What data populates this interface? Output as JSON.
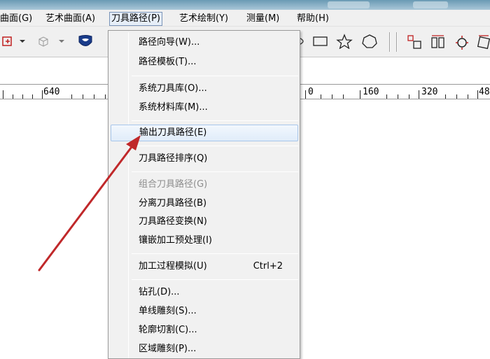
{
  "menubar": {
    "items": [
      {
        "label": "曲面(G)"
      },
      {
        "label": "艺术曲面(A)"
      },
      {
        "label": "刀具路径(P)"
      },
      {
        "label": "艺术绘制(Y)"
      },
      {
        "label": "测量(M)"
      },
      {
        "label": "帮助(H)"
      }
    ]
  },
  "dropdown": {
    "items": [
      {
        "label": "路径向导(W)...",
        "enabled": true
      },
      {
        "label": "路径模板(T)...",
        "enabled": true
      },
      {
        "label": "系统刀具库(O)...",
        "enabled": true
      },
      {
        "label": "系统材料库(M)...",
        "enabled": true
      },
      {
        "label": "输出刀具路径(E)",
        "enabled": true,
        "highlighted": true
      },
      {
        "label": "刀具路径排序(Q)",
        "enabled": true
      },
      {
        "label": "组合刀具路径(G)",
        "enabled": false
      },
      {
        "label": "分离刀具路径(B)",
        "enabled": true
      },
      {
        "label": "刀具路径变换(N)",
        "enabled": true
      },
      {
        "label": "镶嵌加工预处理(I)",
        "enabled": true
      },
      {
        "label": "加工过程模拟(U)",
        "enabled": true,
        "shortcut": "Ctrl+2"
      },
      {
        "label": "钻孔(D)...",
        "enabled": true
      },
      {
        "label": "单线雕刻(S)...",
        "enabled": true
      },
      {
        "label": "轮廓切割(C)...",
        "enabled": true
      },
      {
        "label": "区域雕刻(P)...",
        "enabled": true
      }
    ]
  },
  "ruler": {
    "labels": [
      "640",
      "0",
      "160",
      "320",
      "48"
    ]
  },
  "colors": {
    "arrow": "#c0282a",
    "highlight_border": "#a8c6ea",
    "menu_active_border": "#7a94b8"
  }
}
